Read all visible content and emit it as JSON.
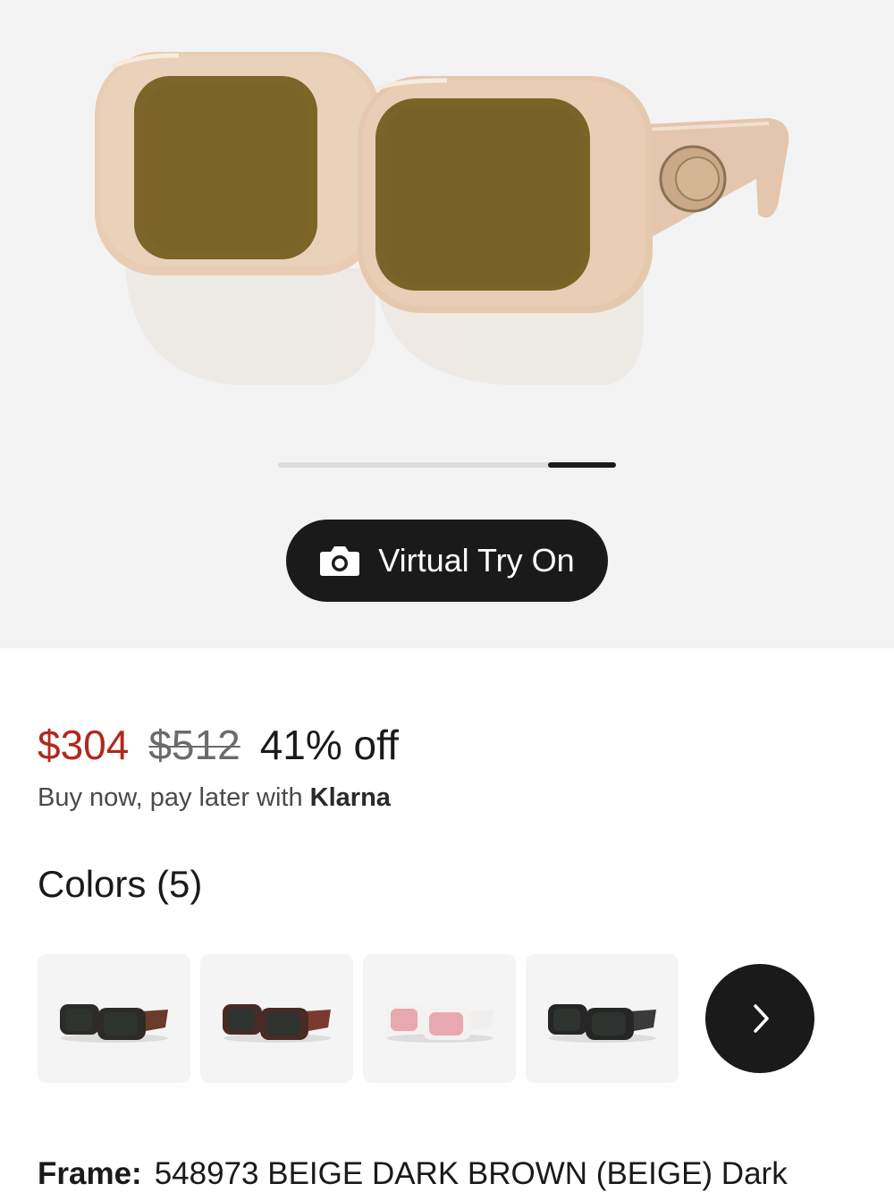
{
  "hero": {
    "product_image": "beige-sunglasses-image",
    "tryon_label": "Virtual Try On",
    "tryon_icon": "camera-icon",
    "carousel_progress": 0.2
  },
  "pricing": {
    "sale_price": "$304",
    "original_price": "$512",
    "discount": "41% off",
    "klarna_text": "Buy now, pay later with",
    "klarna_brand": "Klarna"
  },
  "colors": {
    "title": "Colors (5)",
    "swatches": [
      {
        "name": "black-tortoise",
        "frame": "#2e2a28",
        "temple": "#6a3a2a",
        "lens": "#2f332f"
      },
      {
        "name": "dark-havana",
        "frame": "#4a2a24",
        "temple": "#7a3a30",
        "lens": "#2f332f"
      },
      {
        "name": "white-pink",
        "frame": "#f4f1f1",
        "temple": "#f1eeee",
        "lens": "#e8a8b0"
      },
      {
        "name": "black",
        "frame": "#262626",
        "temple": "#3a3a3a",
        "lens": "#2f332f"
      }
    ],
    "next_icon": "chevron-right-icon"
  },
  "frame": {
    "label": "Frame:",
    "value": "548973 BEIGE DARK BROWN (BEIGE) Dark"
  },
  "colors_theme": {
    "sale_red": "#b0291c",
    "button_dark": "#1a1a1a",
    "hero_bg": "#f3f3f3"
  }
}
